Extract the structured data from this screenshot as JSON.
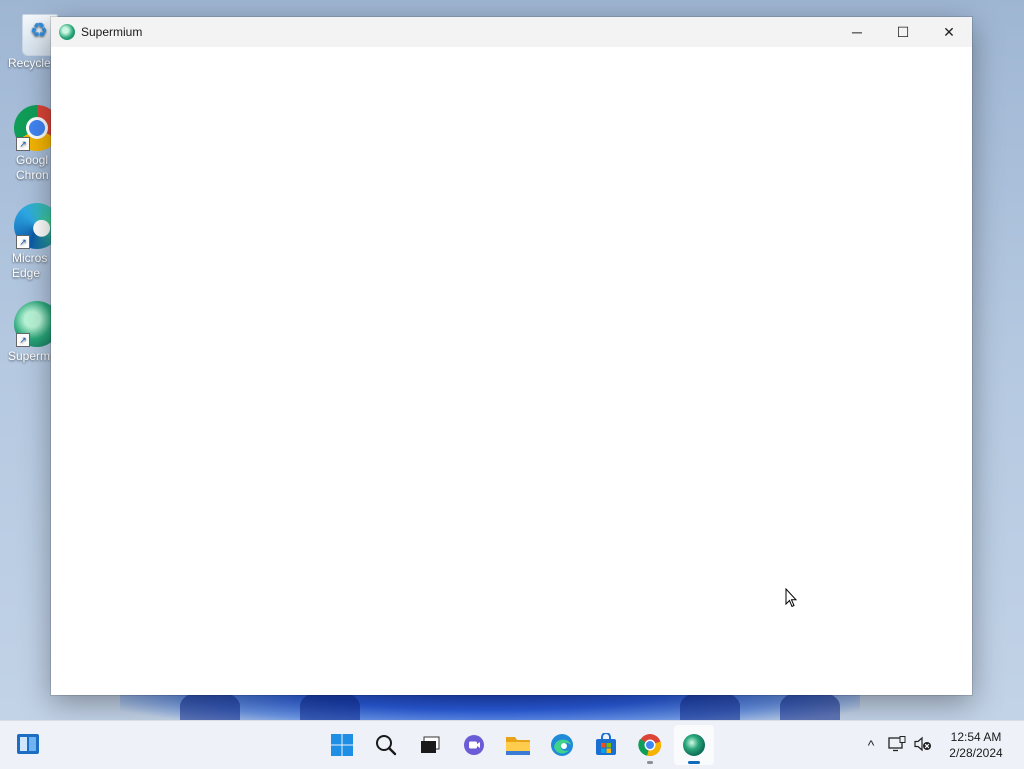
{
  "desktop": {
    "icons": [
      {
        "label": "Recycle",
        "icon": "recycle-bin-icon"
      },
      {
        "label": "Googl\nChron",
        "icon": "chrome-icon"
      },
      {
        "label": "Micros\nEdge",
        "icon": "edge-icon"
      },
      {
        "label": "Superm",
        "icon": "supermium-icon"
      }
    ]
  },
  "window": {
    "title": "Supermium",
    "controls": {
      "minimize_glyph": "─",
      "maximize_glyph": "☐",
      "close_glyph": "✕"
    }
  },
  "taskbar": {
    "apps": [
      {
        "name": "start",
        "icon": "windows-start-icon"
      },
      {
        "name": "search",
        "icon": "search-icon"
      },
      {
        "name": "task-view",
        "icon": "task-view-icon"
      },
      {
        "name": "teams-chat",
        "icon": "teams-chat-icon"
      },
      {
        "name": "file-explorer",
        "icon": "folder-icon"
      },
      {
        "name": "edge",
        "icon": "edge-icon"
      },
      {
        "name": "microsoft-store",
        "icon": "store-icon"
      },
      {
        "name": "chrome",
        "icon": "chrome-icon"
      },
      {
        "name": "supermium",
        "icon": "supermium-icon",
        "active": true
      }
    ],
    "tray": {
      "chevron_glyph": "^",
      "time": "12:54 AM",
      "date": "2/28/2024"
    }
  },
  "colors": {
    "accent": "#0f6cbd",
    "desktop_bg": "#b4c8e0",
    "taskbar_bg": "#eef2f8"
  }
}
